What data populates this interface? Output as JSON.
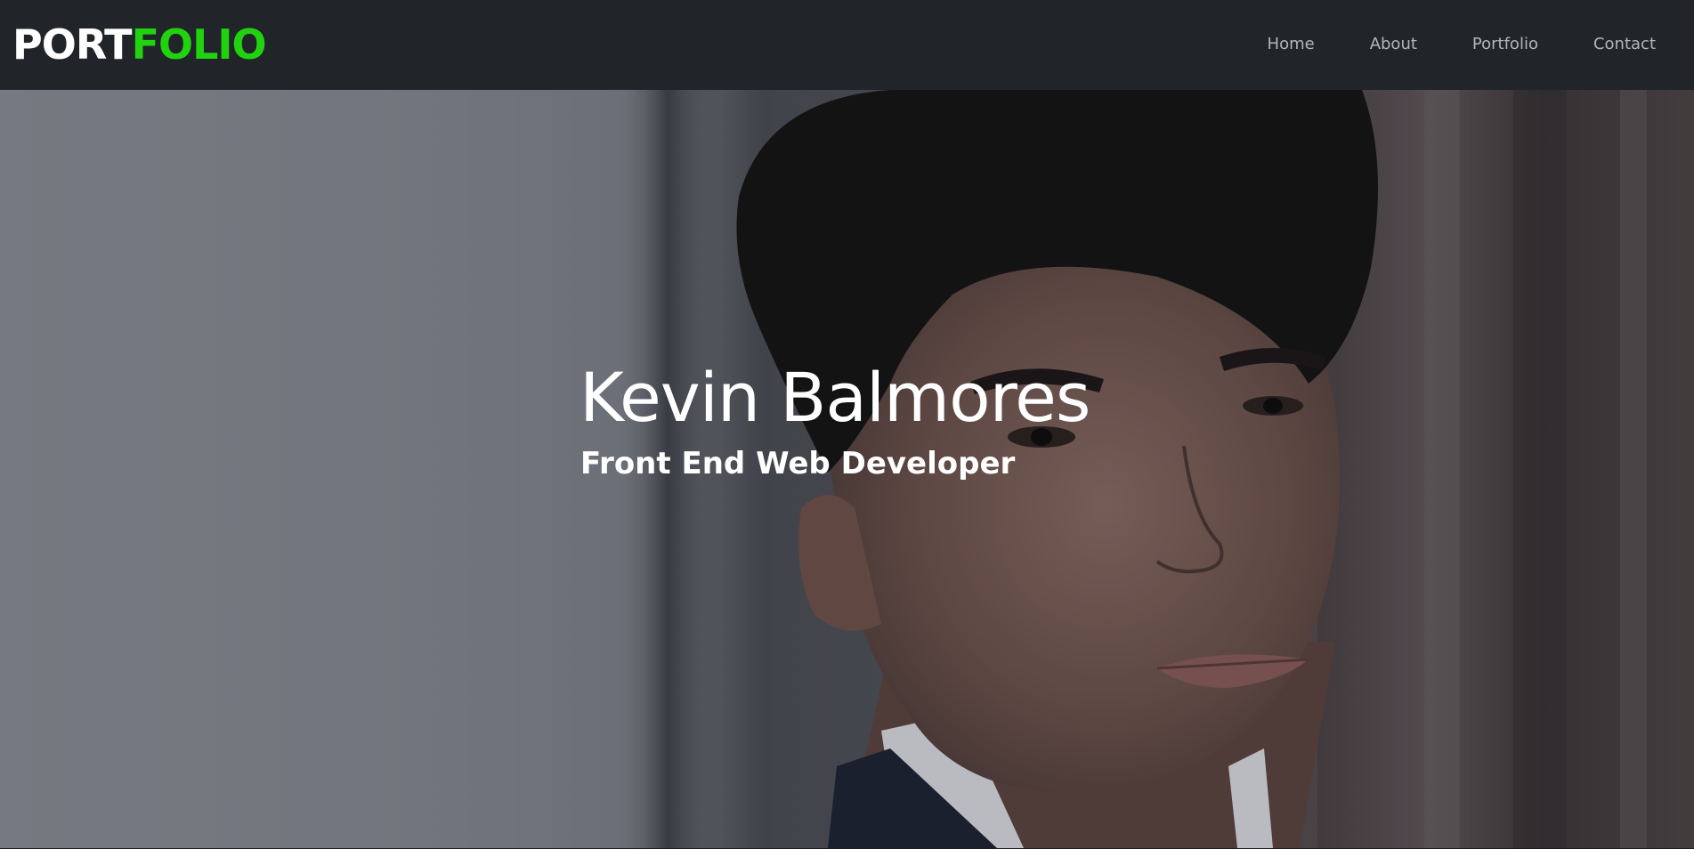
{
  "navbar": {
    "logo": {
      "part1": "PORT",
      "part2": "FOLIO"
    },
    "links": [
      {
        "label": "Home"
      },
      {
        "label": "About"
      },
      {
        "label": "Portfolio"
      },
      {
        "label": "Contact"
      }
    ]
  },
  "hero": {
    "name": "Kevin Balmores",
    "role": "Front End Web Developer"
  },
  "colors": {
    "navbar_bg": "#212429",
    "logo_primary": "#ffffff",
    "logo_accent": "#21d30f",
    "nav_link": "#b3b5b8",
    "hero_text": "#ffffff"
  }
}
